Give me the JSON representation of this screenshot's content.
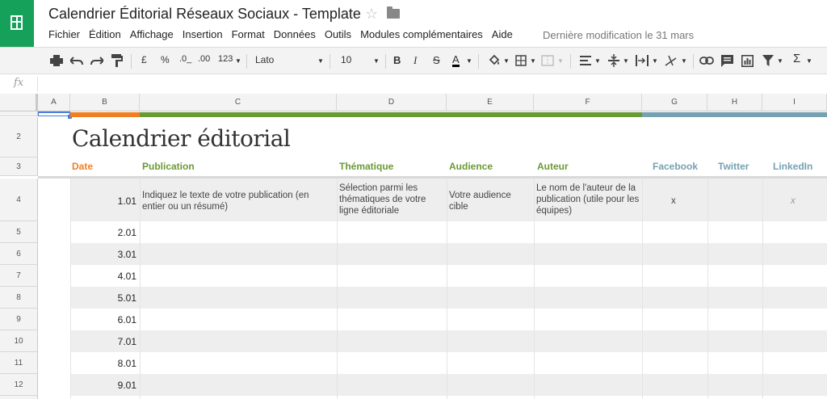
{
  "doc": {
    "title": "Calendrier Éditorial Réseaux Sociaux - Template",
    "last_modified": "Dernière modification le 31 mars"
  },
  "menu": [
    "Fichier",
    "Édition",
    "Affichage",
    "Insertion",
    "Format",
    "Données",
    "Outils",
    "Modules complémentaires",
    "Aide"
  ],
  "toolbar": {
    "currency": "£",
    "percent": "%",
    "dec_less": ".0_",
    "dec_more": ".00",
    "number_format": "123",
    "font": "Lato",
    "font_size": "10",
    "bold": "B",
    "italic": "I",
    "strike": "S",
    "text_color": "A",
    "sum": "Σ"
  },
  "formula_bar": {
    "label": "fx"
  },
  "columns": [
    "A",
    "B",
    "C",
    "D",
    "E",
    "F",
    "G",
    "H",
    "I"
  ],
  "rows": [
    "2",
    "3",
    "4",
    "5",
    "6",
    "7",
    "8",
    "9",
    "10",
    "11",
    "12"
  ],
  "colors": {
    "orange": "#f07f22",
    "green": "#6a9a34",
    "blue": "#76a1b2",
    "band_grey": "#eeeeee"
  },
  "sheet": {
    "title": "Calendrier éditorial",
    "headers": {
      "date": "Date",
      "publication": "Publication",
      "thematique": "Thématique",
      "audience": "Audience",
      "auteur": "Auteur",
      "facebook": "Facebook",
      "twitter": "Twitter",
      "linkedin": "LinkedIn"
    },
    "first_row": {
      "publication": "Indiquez le texte de votre publication (en entier ou un résumé)",
      "thematique": "Sélection parmi les thématiques de votre ligne éditoriale",
      "audience": "Votre audience cible",
      "auteur": "Le nom de l'auteur de la publication (utile pour les équipes)",
      "facebook": "x",
      "linkedin": "x"
    },
    "dates": [
      "1.01",
      "2.01",
      "3.01",
      "4.01",
      "5.01",
      "6.01",
      "7.01",
      "8.01",
      "9.01"
    ]
  }
}
